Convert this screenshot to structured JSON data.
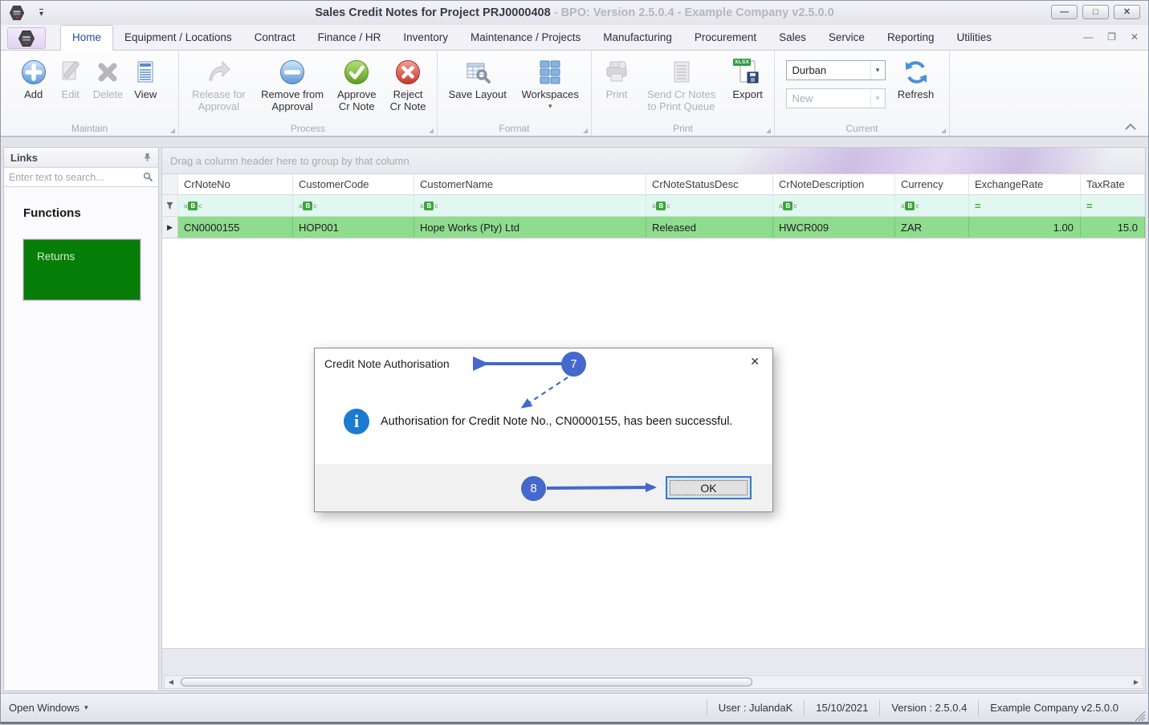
{
  "window": {
    "title": "Sales Credit Notes for Project PRJ0000408",
    "subtitle": " - BPO: Version 2.5.0.4 - Example Company v2.5.0.0"
  },
  "menu_tabs": [
    "Home",
    "Equipment / Locations",
    "Contract",
    "Finance / HR",
    "Inventory",
    "Maintenance / Projects",
    "Manufacturing",
    "Procurement",
    "Sales",
    "Service",
    "Reporting",
    "Utilities"
  ],
  "ribbon": {
    "maintain": {
      "label": "Maintain",
      "add": "Add",
      "edit": "Edit",
      "delete": "Delete",
      "view": "View"
    },
    "process": {
      "label": "Process",
      "release": "Release for Approval",
      "remove": "Remove from Approval",
      "approve": "Approve Cr Note",
      "reject": "Reject Cr Note"
    },
    "format": {
      "label": "Format",
      "save_layout": "Save Layout",
      "workspaces": "Workspaces"
    },
    "print": {
      "label": "Print",
      "print": "Print",
      "send": "Send Cr Notes to Print Queue",
      "export": "Export",
      "export_badge": "XLSX"
    },
    "current": {
      "label": "Current",
      "site_value": "Durban",
      "status_value": "New",
      "refresh": "Refresh"
    }
  },
  "sidebar": {
    "title": "Links",
    "search_placeholder": "Enter text to search...",
    "functions_heading": "Functions",
    "function_tile": "Returns"
  },
  "grid": {
    "group_by_hint": "Drag a column header here to group by that column",
    "columns": [
      "CrNoteNo",
      "CustomerCode",
      "CustomerName",
      "CrNoteStatusDesc",
      "CrNoteDescription",
      "Currency",
      "ExchangeRate",
      "TaxRate"
    ],
    "rows": [
      {
        "CrNoteNo": "CN0000155",
        "CustomerCode": "HOP001",
        "CustomerName": "Hope Works (Pty) Ltd",
        "CrNoteStatusDesc": "Released",
        "CrNoteDescription": "HWCR009",
        "Currency": "ZAR",
        "ExchangeRate": "1.00",
        "TaxRate": "15.0"
      }
    ]
  },
  "dialog": {
    "title": "Credit Note Authorisation",
    "message": "Authorisation for Credit Note No., CN0000155, has been successful.",
    "ok_label": "OK"
  },
  "annotations": {
    "step7": "7",
    "step8": "8"
  },
  "statusbar": {
    "open_windows": "Open Windows",
    "user": "User : JulandaK",
    "date": "15/10/2021",
    "version": "Version : 2.5.0.4",
    "company": "Example Company v2.5.0.0"
  },
  "icons": {
    "caret_down": "▾",
    "minimize": "—",
    "maximize": "□",
    "restore": "❐",
    "close": "✕",
    "info": "i",
    "row_arrow": "▶",
    "scroll_left": "◀",
    "scroll_right": "▶",
    "corner": "◢",
    "equals": "=",
    "abc_a": "a",
    "abc_b": "B",
    "abc_c": "c"
  },
  "colors": {
    "annotation_blue": "#4568cd",
    "selected_row_green": "#90dc8e",
    "filter_row_cyan": "#e1f8f1",
    "function_tile_green": "#067d06",
    "info_icon_blue": "#1d7ad2",
    "ok_border_blue": "#2e7cd6",
    "active_tab_blue": "#1f4e9c"
  }
}
